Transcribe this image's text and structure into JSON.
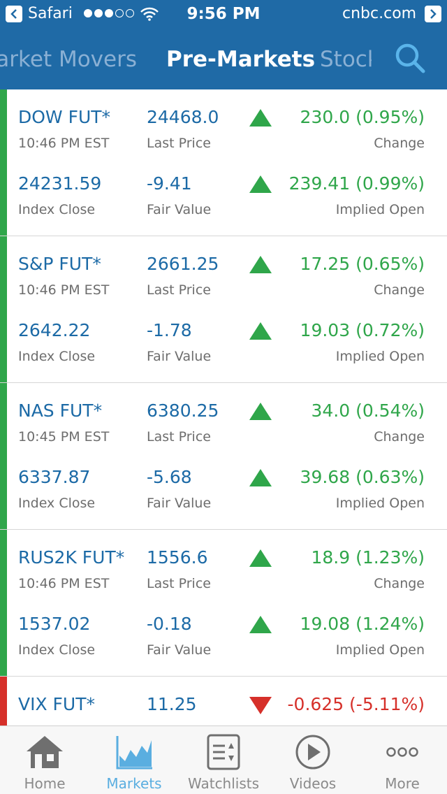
{
  "status_bar": {
    "back_app": "Safari",
    "time": "9:56 PM",
    "domain": "cnbc.com"
  },
  "nav": {
    "tabs": [
      {
        "label": "Market Movers",
        "active": false
      },
      {
        "label": "Pre-Markets",
        "active": true
      },
      {
        "label": "Stocks",
        "active": false
      }
    ],
    "search_icon": "search-icon"
  },
  "futures": [
    {
      "name": "DOW FUT*",
      "time": "10:46 PM EST",
      "last_price": "24468.0",
      "last_price_label": "Last Price",
      "change": "230.0 (0.95%)",
      "change_label": "Change",
      "index_close": "24231.59",
      "index_close_label": "Index Close",
      "fair_value": "-9.41",
      "fair_value_label": "Fair Value",
      "implied_open": "239.41 (0.99%)",
      "implied_open_label": "Implied Open",
      "direction": "up"
    },
    {
      "name": "S&P FUT*",
      "time": "10:46 PM EST",
      "last_price": "2661.25",
      "last_price_label": "Last Price",
      "change": "17.25 (0.65%)",
      "change_label": "Change",
      "index_close": "2642.22",
      "index_close_label": "Index Close",
      "fair_value": "-1.78",
      "fair_value_label": "Fair Value",
      "implied_open": "19.03 (0.72%)",
      "implied_open_label": "Implied Open",
      "direction": "up"
    },
    {
      "name": "NAS FUT*",
      "time": "10:45 PM EST",
      "last_price": "6380.25",
      "last_price_label": "Last Price",
      "change": "34.0 (0.54%)",
      "change_label": "Change",
      "index_close": "6337.87",
      "index_close_label": "Index Close",
      "fair_value": "-5.68",
      "fair_value_label": "Fair Value",
      "implied_open": "39.68 (0.63%)",
      "implied_open_label": "Implied Open",
      "direction": "up"
    },
    {
      "name": "RUS2K FUT*",
      "time": "10:46 PM EST",
      "last_price": "1556.6",
      "last_price_label": "Last Price",
      "change": "18.9 (1.23%)",
      "change_label": "Change",
      "index_close": "1537.02",
      "index_close_label": "Index Close",
      "fair_value": "-0.18",
      "fair_value_label": "Fair Value",
      "implied_open": "19.08 (1.24%)",
      "implied_open_label": "Implied Open",
      "direction": "up"
    },
    {
      "name": "VIX FUT*",
      "last_price": "11.25",
      "change": "-0.625 (-5.11%)",
      "direction": "down"
    }
  ],
  "tab_bar": [
    {
      "label": "Home",
      "icon": "house-icon",
      "active": false
    },
    {
      "label": "Markets",
      "icon": "chart-icon",
      "active": true
    },
    {
      "label": "Watchlists",
      "icon": "list-icon",
      "active": false
    },
    {
      "label": "Videos",
      "icon": "play-icon",
      "active": false
    },
    {
      "label": "More",
      "icon": "more-icon",
      "active": false
    }
  ],
  "colors": {
    "header_blue": "#1f6aa6",
    "value_blue": "#1c6aa6",
    "up_green": "#2fa64a",
    "down_red": "#d6302a",
    "active_tab": "#5aaee0"
  }
}
